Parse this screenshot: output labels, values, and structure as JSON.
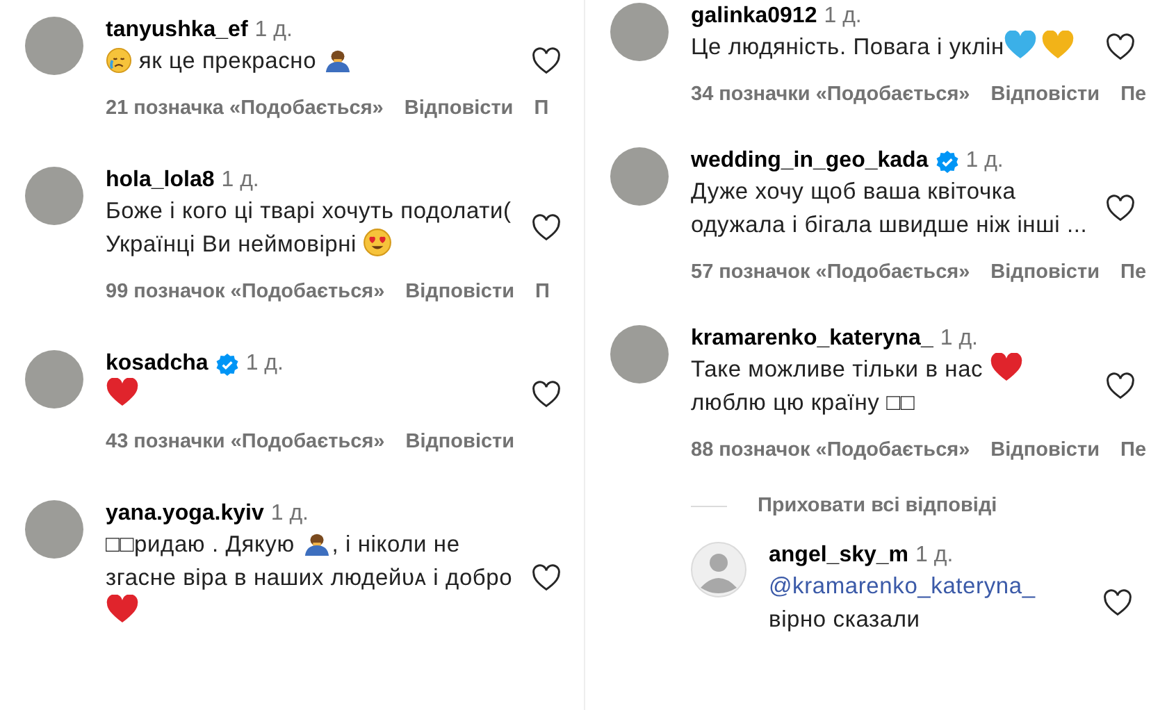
{
  "columns": [
    {
      "comments": [
        {
          "author": "tanyushka_ef",
          "verified": false,
          "time": "1 д.",
          "avatar": {
            "kind": "photo"
          },
          "body": [
            {
              "kind": "sad"
            },
            {
              "kind": "text",
              "text": " як це прекрасно "
            },
            {
              "kind": "bow"
            }
          ],
          "likes": "21 позначка «Подобається»",
          "reply": "Відповісти",
          "more": "П"
        },
        {
          "author": "hola_lola8",
          "verified": false,
          "time": "1 д.",
          "avatar": {
            "kind": "photo"
          },
          "body": [
            {
              "kind": "text",
              "text": "Боже і кого ці тварі хочуть подолати( Українці Ви неймовірні "
            },
            {
              "kind": "smitten"
            }
          ],
          "likes": "99 позначок «Подобається»",
          "reply": "Відповісти",
          "more": "П"
        },
        {
          "author": "kosadcha",
          "verified": true,
          "time": "1 д.",
          "avatar": {
            "kind": "photo"
          },
          "body": [
            {
              "kind": "heart",
              "color": "#e0242c"
            }
          ],
          "likes": "43 позначки «Подобається»",
          "reply": "Відповісти"
        },
        {
          "author": "yana.yoga.kyiv",
          "verified": false,
          "time": "1 д.",
          "avatar": {
            "kind": "photo"
          },
          "body": [
            {
              "kind": "text",
              "text": "□□ридаю . Дякую "
            },
            {
              "kind": "bow"
            },
            {
              "kind": "text",
              "text": ", і ніколи не згасне віра в наших людейᴜᴀ і добро "
            },
            {
              "kind": "heart",
              "color": "#e0242c"
            }
          ]
        }
      ]
    },
    {
      "comments": [
        {
          "author": "galinka0912",
          "verified": false,
          "time": "1 д.",
          "avatar": {
            "kind": "photo"
          },
          "body": [
            {
              "kind": "text",
              "text": "Це людяність. Повага і уклін"
            },
            {
              "kind": "heart",
              "color": "#3bb0e8"
            },
            {
              "kind": "heart",
              "color": "#f2b318"
            }
          ],
          "likes": "34 позначки «Подобається»",
          "reply": "Відповісти",
          "more": "Пе"
        },
        {
          "author": "wedding_in_geo_kada",
          "verified": true,
          "time": "1 д.",
          "avatar": {
            "kind": "photo"
          },
          "body": [
            {
              "kind": "text",
              "text": "Дуже хочу щоб ваша квіточка одужала і бігала швидше ніж інші ..."
            }
          ],
          "likes": "57 позначок «Подобається»",
          "reply": "Відповісти",
          "more": "Пе"
        },
        {
          "author": "kramarenko_kateryna_",
          "verified": false,
          "time": "1 д.",
          "avatar": {
            "kind": "photo"
          },
          "body": [
            {
              "kind": "text",
              "text": "Таке можливе тільки в нас "
            },
            {
              "kind": "heart",
              "color": "#e0242c"
            },
            {
              "kind": "text",
              "text": " люблю цю країну □□"
            }
          ],
          "likes": "88 позначок «Подобається»",
          "reply": "Відповісти",
          "more": "Пе",
          "hide_replies": "Приховати всі відповіді",
          "replies": [
            {
              "author": "angel_sky_m",
              "verified": false,
              "time": "1 д.",
              "avatar": {
                "kind": "default"
              },
              "body": [
                {
                  "kind": "mention",
                  "text": "@kramarenko_kateryna_"
                },
                {
                  "kind": "text",
                  "text": " вірно сказали"
                }
              ]
            }
          ]
        }
      ]
    }
  ]
}
